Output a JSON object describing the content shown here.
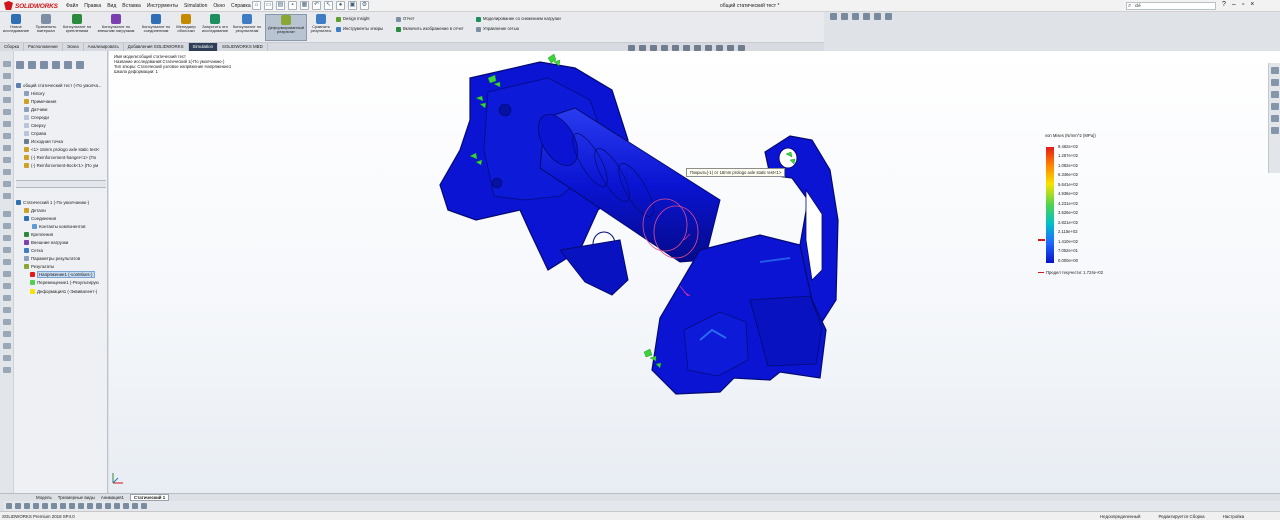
{
  "window": {
    "app_name": "SOLIDWORKS",
    "doc_title": "общий статический тест *",
    "menu": [
      "Файл",
      "Правка",
      "Вид",
      "Вставка",
      "Инструменты",
      "Simulation",
      "Окно",
      "Справка"
    ],
    "search_placeholder": "clé"
  },
  "command_manager": {
    "buttons": [
      {
        "label": "Новое исследование",
        "icon": "new-study-icon",
        "color": "#2f6fb5"
      },
      {
        "label": "Применить материал",
        "icon": "apply-material-icon",
        "color": "#7d8fa5"
      },
      {
        "label": "Консультант по креплениям",
        "icon": "fixtures-advisor-icon",
        "color": "#2b8a3e"
      },
      {
        "label": "Консультант по внешним нагрузкам",
        "icon": "external-loads-icon",
        "color": "#7a3fb0"
      },
      {
        "label": "Консультант по соединениям",
        "icon": "connections-advisor-icon",
        "color": "#2f6fb5"
      },
      {
        "label": "Менеджер оболочки",
        "icon": "shell-manager-icon",
        "color": "#c58b00"
      },
      {
        "label": "Запустить это исследование",
        "icon": "run-study-icon",
        "color": "#1d8f5e"
      },
      {
        "label": "Консультант по результатам",
        "icon": "results-advisor-icon",
        "color": "#3e7cc4"
      },
      {
        "label": "Деформированный результат",
        "icon": "deformed-result-icon",
        "color": "#8aa634"
      },
      {
        "label": "Сравнить результаты",
        "icon": "compare-results-icon",
        "color": "#3e7cc4"
      }
    ],
    "list_col1": [
      "Design Insight",
      "Инструменты эпюры"
    ],
    "list_col2": [
      "Отчет",
      "Включить изображение в отчет"
    ],
    "list_col3": [
      "Моделирование со снижением нагрузки",
      "Управление сетью"
    ]
  },
  "cmd_tabs": [
    "Сборка",
    "Расположение",
    "Эскиз",
    "Анализировать",
    "Добавления SOLIDWORKS",
    "Simulation",
    "SOLIDWORKS MBD"
  ],
  "cmd_tabs_active": 5,
  "tree_top": {
    "root": "общий статический тест (-По умолча...",
    "items": [
      "History",
      "Примечания",
      "Датчики",
      "Спереди",
      "Сверху",
      "Справа",
      "Исходная точка",
      "<1> 16mm prologo axle static test<",
      "(-) Reinforcement-hanger<1> (По",
      "(-) Reinforcement-8ock<1> (По ум"
    ]
  },
  "tree_study": {
    "root": "Статический 1 (-По умолчанию-)",
    "items": [
      "Детали",
      "Соединения",
      "Контакты компонентов",
      "Крепления",
      "Внешние нагрузки",
      "Сетка",
      "Параметры результатов",
      "Результаты",
      "Напряжение1 (-vonMises-)",
      "Перемещение1 (-Результирую",
      "Деформация1 (-Эквивалент-)"
    ]
  },
  "study_info": [
    "Имя модели:общий статический тест",
    "Название исследования:Статический 1(-По умолчанию-)",
    "Тип эпюры: Статический узловое напряжение Напряжение1",
    "Шкала деформации: 1"
  ],
  "legend": {
    "title": "von Mises (N/mm^2 (MPa))",
    "values": [
      "9.462e+02",
      "1.257e+02",
      "1.082e+02",
      "6.346e+02",
      "5.641e+02",
      "4.936e+02",
      "4.231e+02",
      "3.526e+02",
      "2.821e+02",
      "2.115e+02",
      "1.410e+02",
      "7.052e+01",
      "0.000e+00"
    ],
    "yield_label": "Предел текучести: 1.724e+02"
  },
  "tooltip": "Покрыть(-1) от 16mm prologo axle static test<1>",
  "bottom_tabs": [
    "Модель",
    "Трехмерные виды",
    "Анимация1",
    "Статический 1"
  ],
  "bottom_tab_active": 3,
  "status": {
    "left": "SOLIDWORKS Premium 2018 SP4.0",
    "right": [
      "Недоопределенный",
      "Редактируется Сборка",
      "Настройка"
    ]
  },
  "colors": {
    "accent": "#d0161b",
    "model_blue": "#0a14d2",
    "selection": "#c7dcf3"
  }
}
